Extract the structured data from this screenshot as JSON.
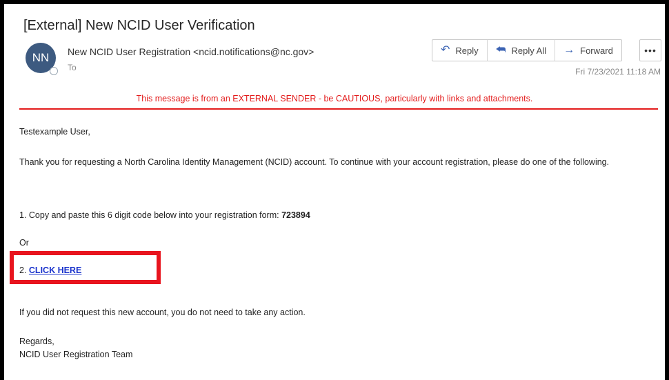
{
  "email": {
    "subject": "[External] New NCID User Verification",
    "avatar_initials": "NN",
    "sender": "New NCID User Registration <ncid.notifications@nc.gov>",
    "to_label": "To",
    "timestamp": "Fri 7/23/2021 11:18 AM"
  },
  "actions": {
    "reply": "Reply",
    "reply_all": "Reply All",
    "forward": "Forward",
    "more": "•••"
  },
  "warning": "This message is from an EXTERNAL SENDER - be CAUTIOUS, particularly with links and attachments.",
  "body": {
    "greeting": "Testexample User,",
    "paragraph": "Thank you for requesting a North Carolina Identity Management (NCID) account. To continue with your account registration, please do one of the following.",
    "step1_prefix": "1. Copy and paste this 6 digit code below into your registration form: ",
    "code": "723894",
    "or": "Or",
    "step2_prefix": "2. ",
    "step2_link": "CLICK HERE",
    "no_action": "If you did not request this new account, you do not need to take any action.",
    "regards": "Regards,",
    "team": "NCID User Registration Team"
  },
  "colors": {
    "warning": "#e31b1b",
    "link": "#1a33cc",
    "highlight": "#e8141e",
    "avatar": "#3d5a80"
  }
}
